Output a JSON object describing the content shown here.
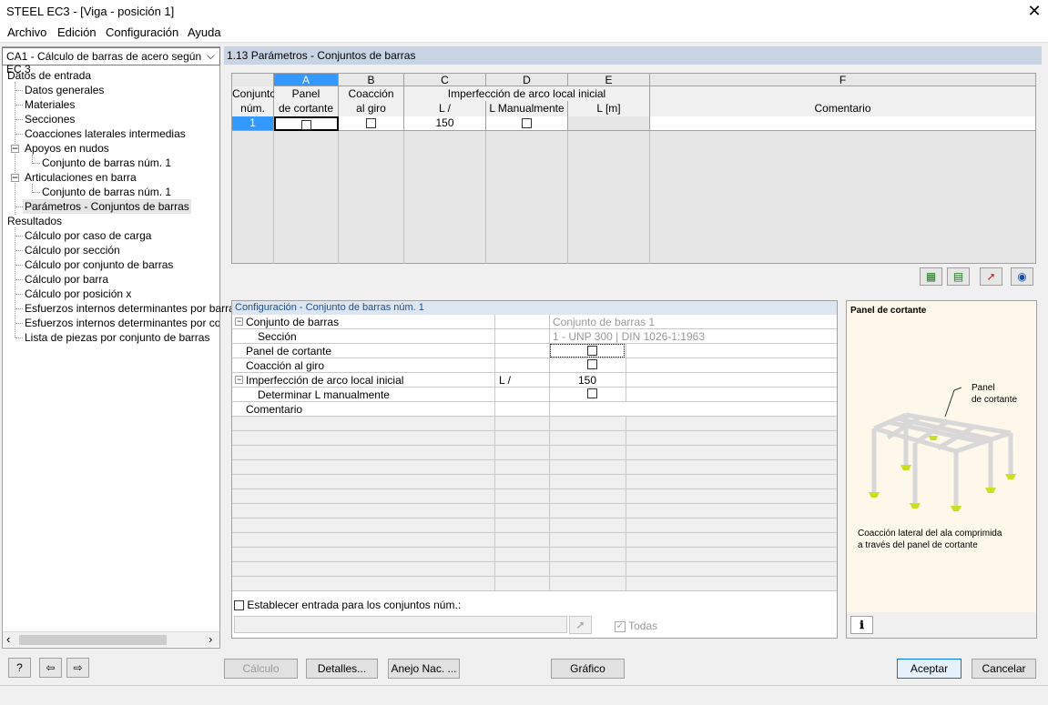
{
  "window": {
    "title": "STEEL EC3 - [Viga - posición 1]"
  },
  "menu": [
    "Archivo",
    "Edición",
    "Configuración",
    "Ayuda"
  ],
  "case_selector": "CA1 - Cálculo de barras de acero según EC 3",
  "tree": {
    "datos": "Datos de entrada",
    "items": [
      "Datos generales",
      "Materiales",
      "Secciones",
      "Coacciones laterales intermedias",
      "Apoyos en nudos",
      "Conjunto de barras núm. 1",
      "Articulaciones en barra",
      "Conjunto de barras núm. 1",
      "Parámetros - Conjuntos de barras"
    ],
    "resultados": "Resultados",
    "results": [
      "Cálculo por caso de carga",
      "Cálculo por sección",
      "Cálculo por conjunto de barras",
      "Cálculo por barra",
      "Cálculo por posición x",
      "Esfuerzos internos determinantes por barra",
      "Esfuerzos internos determinantes por conjun",
      "Lista de piezas por conjunto de barras"
    ]
  },
  "section_title": "1.13 Parámetros - Conjuntos de barras",
  "table": {
    "col_letters": [
      "A",
      "B",
      "C",
      "D",
      "E",
      "F"
    ],
    "hdr_conjunto": [
      "Conjunto",
      "núm."
    ],
    "hdr_panel": [
      "Panel",
      "de cortante"
    ],
    "hdr_coaccion": [
      "Coacción",
      "al giro"
    ],
    "hdr_imperf": "Imperfección de arco local inicial",
    "hdr_L": "L /",
    "hdr_Lman": "L Manualmente",
    "hdr_Lm": "L [m]",
    "hdr_coment": "Comentario",
    "row": {
      "num": "1",
      "L": "150"
    }
  },
  "config": {
    "title": "Configuración - Conjunto de barras núm. 1",
    "rows": {
      "conjunto": "Conjunto de barras",
      "conjunto_val": "Conjunto de barras 1",
      "seccion": "Sección",
      "seccion_val": "1 - UNP 300 | DIN 1026-1:1963",
      "panel": "Panel de cortante",
      "coaccion": "Coacción al giro",
      "imperf": "Imperfección de arco local inicial",
      "imperf_unit": "L /",
      "imperf_val": "150",
      "determinar": "Determinar L manualmente",
      "comentario": "Comentario"
    },
    "establecer": "Establecer entrada para los conjuntos núm.:",
    "todas": "Todas"
  },
  "info": {
    "title": "Panel de cortante",
    "callout1": "Panel",
    "callout2": "de cortante",
    "desc1": "Coacción lateral del ala comprimida",
    "desc2": "a través del panel de cortante"
  },
  "buttons": {
    "calculo": "Cálculo",
    "detalles": "Detalles...",
    "anejo": "Anejo Nac. ...",
    "grafico": "Gráfico",
    "aceptar": "Aceptar",
    "cancelar": "Cancelar"
  }
}
